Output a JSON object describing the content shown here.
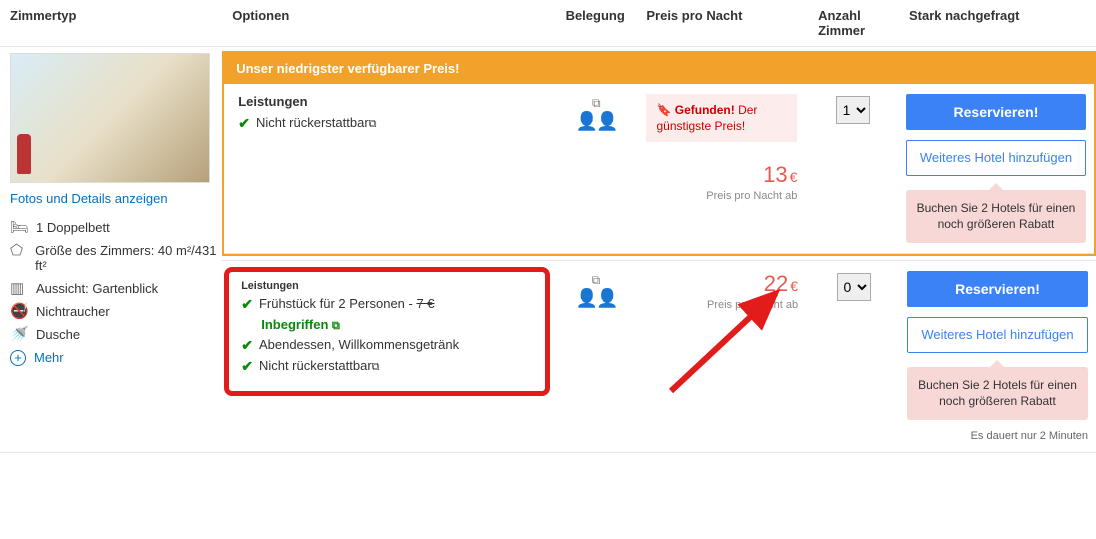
{
  "headers": {
    "roomtype": "Zimmertyp",
    "options": "Optionen",
    "occupancy": "Belegung",
    "price": "Preis pro Nacht",
    "qty_line1": "Anzahl",
    "qty_line2": "Zimmer",
    "demand": "Stark nachgefragt"
  },
  "room": {
    "photo_link": "Fotos und Details anzeigen",
    "amenities": {
      "bed": "1 Doppelbett",
      "size": "Größe des Zimmers: 40 m²/431 ft²",
      "view": "Aussicht: Gartenblick",
      "smoke": "Nichtraucher",
      "shower": "Dusche",
      "more": "Mehr"
    }
  },
  "option1": {
    "banner": "Unser niedrigster verfügbarer Preis!",
    "features_title": "Leistungen",
    "feat_nonref": "Nicht rückerstattbar",
    "found_label": "Gefunden!",
    "found_rest": " Der günstigste Preis!",
    "price_value": "13",
    "price_currency": "€",
    "price_sub": "Preis pro Nacht ab",
    "qty_selected": "1",
    "reserve": "Reservieren!",
    "add_hotel": "Weiteres Hotel hinzufügen",
    "promo": "Buchen Sie 2 Hotels für einen noch größeren Rabatt"
  },
  "option2": {
    "features_title": "Leistungen",
    "feat_breakfast_pre": "Frühstück für 2 Personen - ",
    "feat_breakfast_strike": "7 €",
    "feat_breakfast_incl": "Inbegriffen",
    "feat_dinner": "Abendessen, Willkommensgetränk",
    "feat_nonref": "Nicht rückerstattbar",
    "price_value": "22",
    "price_currency": "€",
    "price_sub": "Preis pro Nacht ab",
    "qty_selected": "0",
    "reserve": "Reservieren!",
    "add_hotel": "Weiteres Hotel hinzufügen",
    "promo": "Buchen Sie 2 Hotels für einen noch größeren Rabatt",
    "mini_note": "Es dauert nur 2 Minuten"
  }
}
